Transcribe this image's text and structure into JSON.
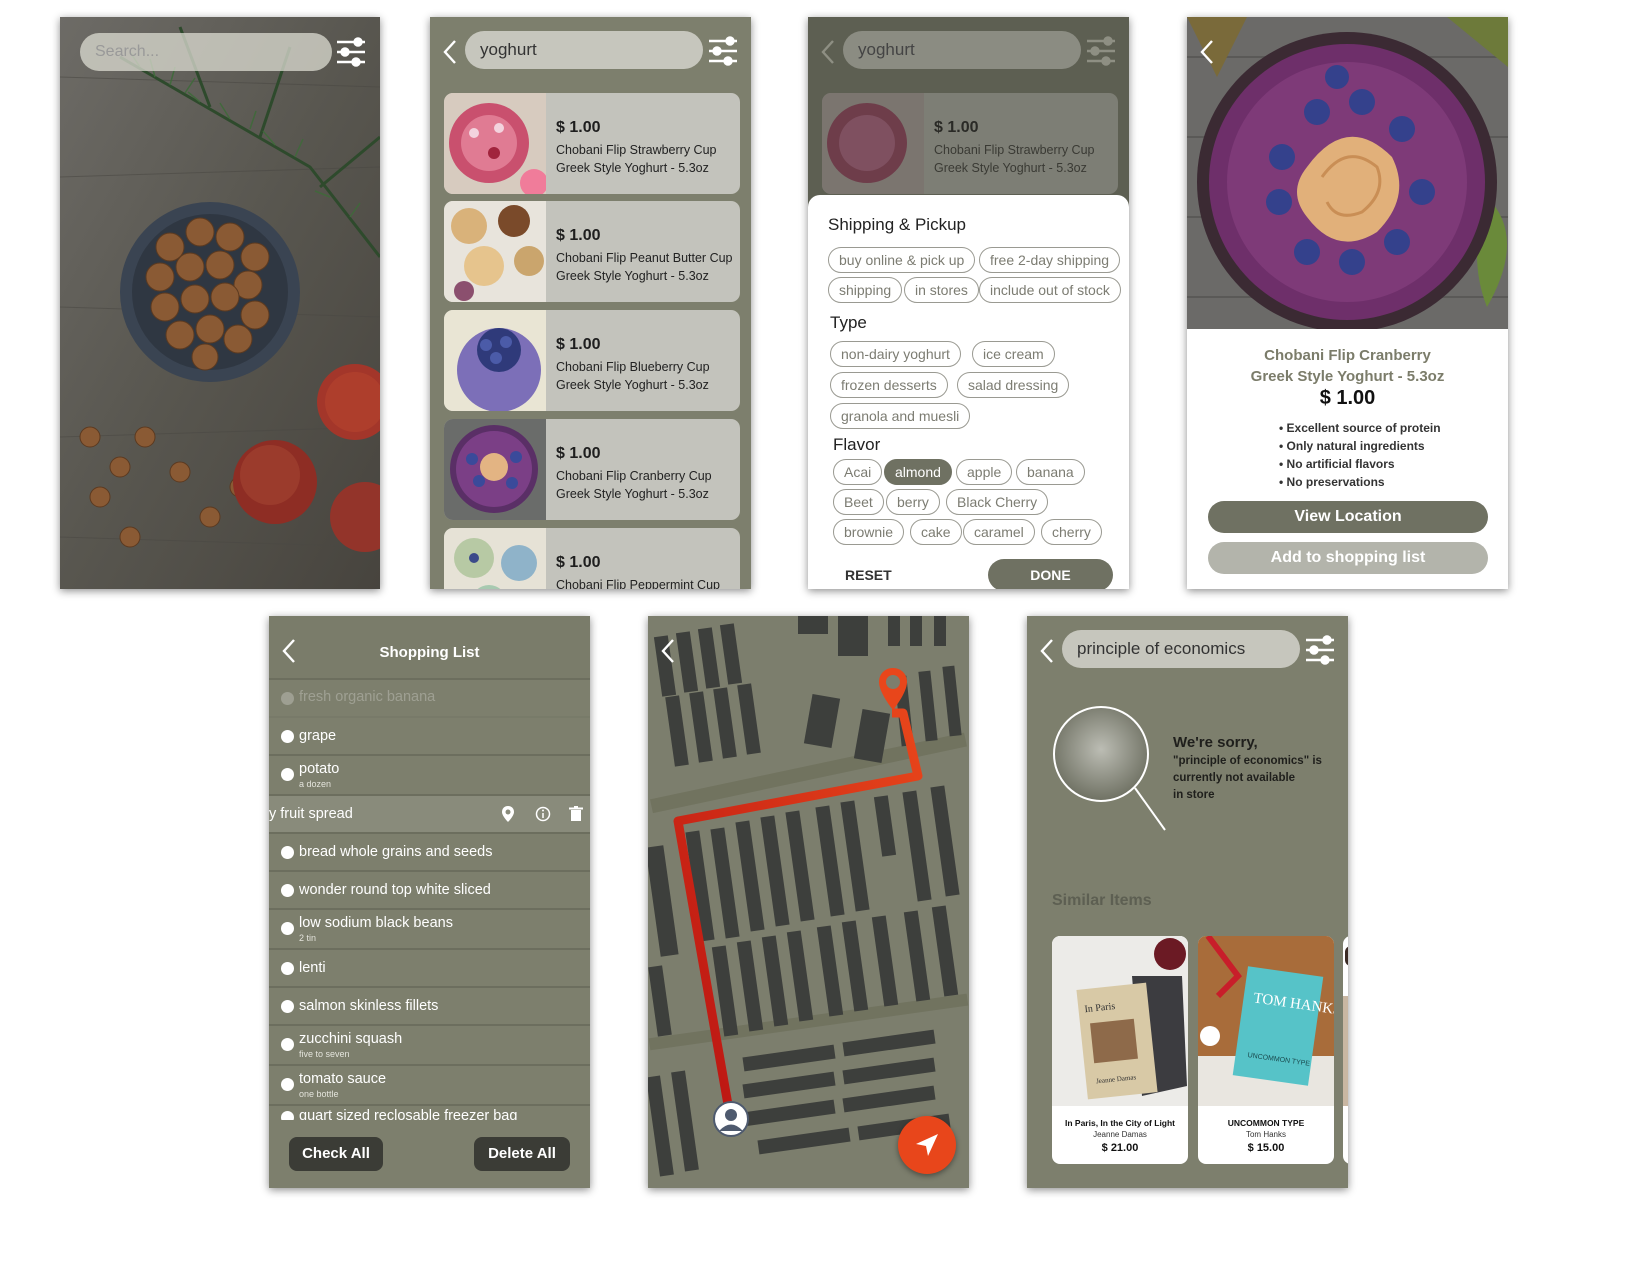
{
  "screen_home": {
    "search_placeholder": "Search..."
  },
  "screen_results": {
    "query": "yoghurt",
    "items": [
      {
        "price": "$ 1.00",
        "name_line1": "Chobani Flip Strawberry Cup",
        "name_line2": "Greek Style Yoghurt - 5.3oz",
        "thumb": "strawberry-bowl"
      },
      {
        "price": "$ 1.00",
        "name_line1": "Chobani Flip Peanut Butter Cup",
        "name_line2": "Greek Style Yoghurt - 5.3oz",
        "thumb": "peanut-bowls"
      },
      {
        "price": "$ 1.00",
        "name_line1": "Chobani Flip Blueberry Cup",
        "name_line2": "Greek Style Yoghurt - 5.3oz",
        "thumb": "blueberry-bowl"
      },
      {
        "price": "$ 1.00",
        "name_line1": "Chobani Flip Cranberry Cup",
        "name_line2": "Greek Style Yoghurt - 5.3oz",
        "thumb": "cranberry-bowl"
      },
      {
        "price": "$ 1.00",
        "name_line1": "Chobani Flip Peppermint Cup",
        "name_line2": "",
        "thumb": "peppermint-bowls"
      }
    ]
  },
  "screen_filter": {
    "query": "yoghurt",
    "behind_item": {
      "price": "$ 1.00",
      "name_line1": "Chobani Flip Strawberry Cup",
      "name_line2": "Greek Style Yoghurt - 5.3oz"
    },
    "sections": {
      "shipping": {
        "title": "Shipping & Pickup",
        "chips": [
          "buy online & pick up",
          "free 2-day shipping",
          "shipping",
          "in stores",
          "include out of stock"
        ]
      },
      "type": {
        "title": "Type",
        "chips": [
          "non-dairy yoghurt",
          "ice cream",
          "frozen desserts",
          "salad dressing",
          "granola and muesli"
        ]
      },
      "flavor": {
        "title": "Flavor",
        "chips": [
          "Acai",
          "almond",
          "apple",
          "banana",
          "Beet",
          "berry",
          "Black Cherry",
          "brownie",
          "cake",
          "caramel",
          "cherry"
        ],
        "selected": "almond"
      }
    },
    "reset_label": "RESET",
    "done_label": "DONE"
  },
  "screen_detail": {
    "title_line1": "Chobani Flip Cranberry",
    "title_line2": "Greek Style Yoghurt - 5.3oz",
    "price": "$ 1.00",
    "bullets": [
      "Excellent source of protein",
      "Only natural ingredients",
      "No artificial flavors",
      "No preservations"
    ],
    "view_location_label": "View Location",
    "add_to_list_label": "Add to shopping list"
  },
  "screen_list": {
    "title": "Shopping List",
    "faded_item": "fresh organic banana",
    "items": [
      {
        "text": "grape",
        "sub": ""
      },
      {
        "text": "potato",
        "sub": "a dozen"
      },
      {
        "text": "y fruit spread",
        "sub": "",
        "swiped": true
      },
      {
        "text": "bread whole grains and seeds",
        "sub": ""
      },
      {
        "text": "wonder round top white sliced",
        "sub": ""
      },
      {
        "text": "low sodium black beans",
        "sub": "2 tin"
      },
      {
        "text": "lenti",
        "sub": ""
      },
      {
        "text": "salmon skinless fillets",
        "sub": ""
      },
      {
        "text": "zucchini squash",
        "sub": "five to seven"
      },
      {
        "text": "tomato sauce",
        "sub": "one bottle"
      },
      {
        "text": "quart sized reclosable freezer bag",
        "sub": ""
      }
    ],
    "check_all_label": "Check All",
    "delete_all_label": "Delete All"
  },
  "screen_map": {
    "route_color": "#e8461b"
  },
  "screen_notfound": {
    "query": "principle of economics",
    "sorry_title": "We're sorry,",
    "sorry_line1": "\"principle of economics\" is",
    "sorry_line2": "currently not available",
    "sorry_line3": "in store",
    "similar_title": "Similar Items",
    "books": [
      {
        "title": "In Paris, In the City of Light",
        "author": "Jeanne Damas",
        "price": "$ 21.00",
        "cover_title": "In Paris",
        "cover_author": "Jeanne Damas"
      },
      {
        "title": "UNCOMMON TYPE",
        "author": "Tom Hanks",
        "price": "$ 15.00",
        "cover_title": "TOM HANKS",
        "cover_sub": "UNCOMMON TYPE"
      }
    ]
  },
  "colors": {
    "olive": "#7d7f6d",
    "dark_olive": "#6f7162",
    "accent_orange": "#e8461b"
  }
}
